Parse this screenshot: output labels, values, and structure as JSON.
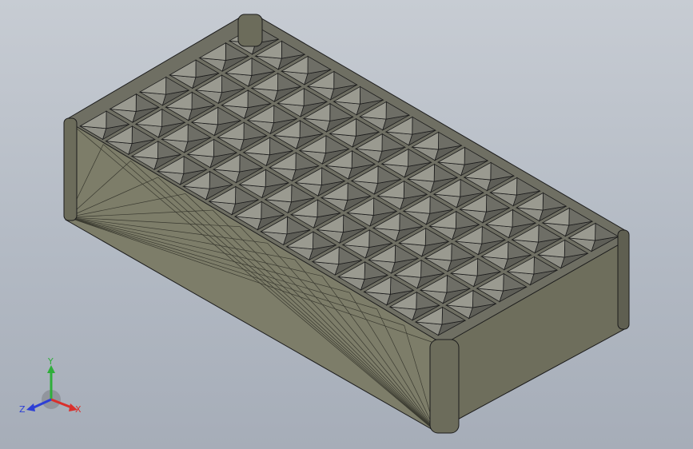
{
  "viewport": {
    "model_name": "",
    "colors": {
      "background_top": "#c7ccd3",
      "background_bottom": "#a6adb8",
      "body_side": "#7a7a66",
      "body_dark": "#6b6b5a",
      "cell_light": "#8d8d80",
      "cell_dark": "#5a5a52",
      "edge": "#1c1c1c"
    },
    "tray": {
      "rows": 6,
      "cols": 14
    }
  },
  "triad": {
    "x_label": "X",
    "y_label": "Y",
    "z_label": "Z",
    "x_color": "#d9302c",
    "y_color": "#2fae3a",
    "z_color": "#2d3fd6"
  }
}
